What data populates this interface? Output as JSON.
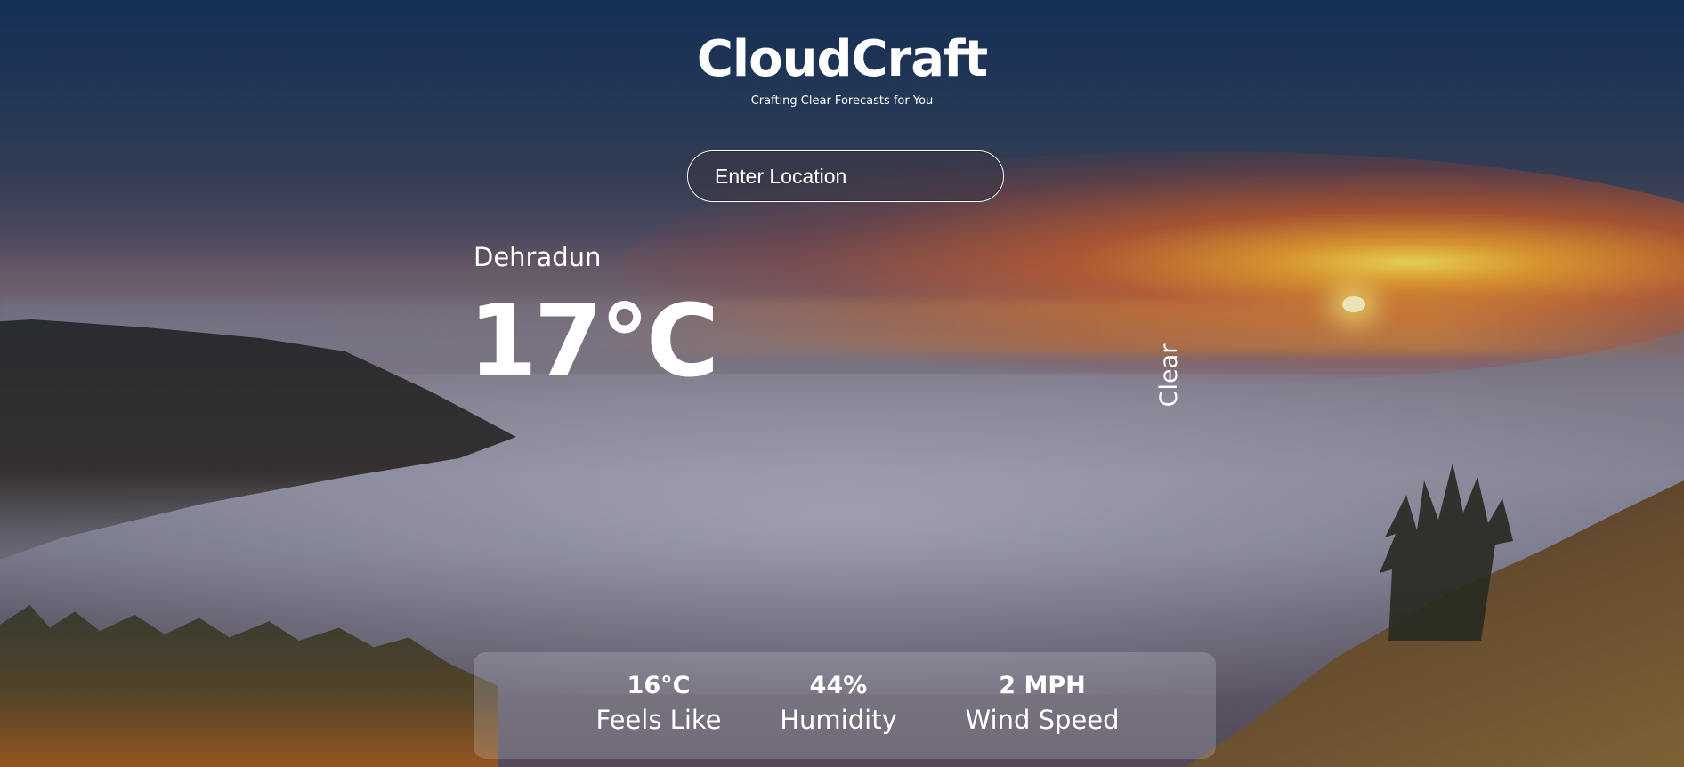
{
  "app": {
    "title": "CloudCraft",
    "subtitle": "Crafting Clear Forecasts for You"
  },
  "search": {
    "placeholder": "Enter Location",
    "value": ""
  },
  "weather": {
    "location": "Dehradun",
    "temperature": "17°C",
    "condition": "Clear"
  },
  "stats": {
    "feels_like": {
      "value": "16°C",
      "label": "Feels Like"
    },
    "humidity": {
      "value": "44%",
      "label": "Humidity"
    },
    "wind_speed": {
      "value": "2 MPH",
      "label": "Wind Speed"
    }
  }
}
